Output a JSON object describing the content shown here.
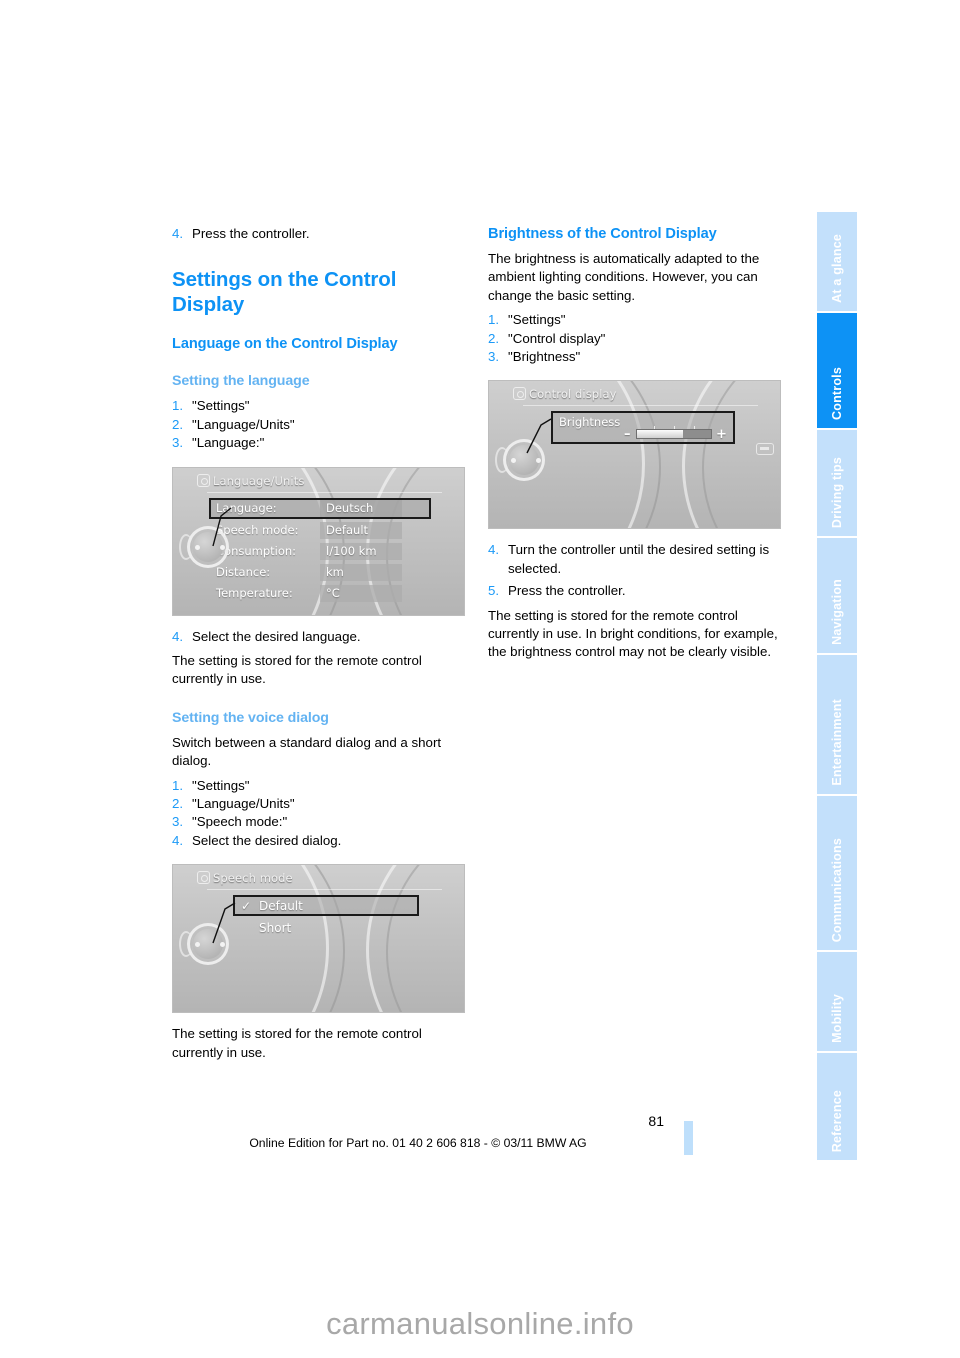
{
  "document": {
    "page_number": "81",
    "edition_line": "Online Edition for Part no. 01 40 2 606 818 - © 03/11 BMW AG",
    "watermark": "carmanualsonline.info"
  },
  "sidebar": {
    "tabs": [
      {
        "label": "At a glance",
        "active": false
      },
      {
        "label": "Controls",
        "active": true
      },
      {
        "label": "Driving tips",
        "active": false
      },
      {
        "label": "Navigation",
        "active": false
      },
      {
        "label": "Entertainment",
        "active": false
      },
      {
        "label": "Communications",
        "active": false
      },
      {
        "label": "Mobility",
        "active": false
      },
      {
        "label": "Reference",
        "active": false
      }
    ],
    "active_color": "#0d92f5",
    "inactive_color": "#c3e0fb"
  },
  "left_column": {
    "step4_top": {
      "num": "4.",
      "text": "Press the controller."
    },
    "h1": "Settings on the Control Display",
    "h2_language": "Language on the Control Display",
    "h3_setting_language": "Setting the language",
    "language_steps": [
      {
        "num": "1.",
        "text": "\"Settings\""
      },
      {
        "num": "2.",
        "text": "\"Language/Units\""
      },
      {
        "num": "3.",
        "text": "\"Language:\""
      }
    ],
    "figure_language": {
      "title": "Language/Units",
      "rows": [
        {
          "label": "Language:",
          "value": "Deutsch",
          "selected": true
        },
        {
          "label": "Speech mode:",
          "value": "Default",
          "selected": false
        },
        {
          "label": "Consumption:",
          "value": "l/100 km",
          "selected": false
        },
        {
          "label": "Distance:",
          "value": "km",
          "selected": false
        },
        {
          "label": "Temperature:",
          "value": "°C",
          "selected": false
        }
      ]
    },
    "language_step4": {
      "num": "4.",
      "text": "Select the desired language."
    },
    "stored_note_1": "The setting is stored for the remote control currently in use.",
    "h3_voice_dialog": "Setting the voice dialog",
    "voice_intro": "Switch between a standard dialog and a short dialog.",
    "voice_steps": [
      {
        "num": "1.",
        "text": "\"Settings\""
      },
      {
        "num": "2.",
        "text": "\"Language/Units\""
      },
      {
        "num": "3.",
        "text": "\"Speech mode:\""
      },
      {
        "num": "4.",
        "text": "Select the desired dialog."
      }
    ],
    "figure_speech": {
      "title": "Speech mode",
      "items": [
        {
          "label": "Default",
          "checked": true,
          "selected": true
        },
        {
          "label": "Short",
          "checked": false,
          "selected": false
        }
      ]
    },
    "stored_note_2": "The setting is stored for the remote control currently in use."
  },
  "right_column": {
    "h2_brightness": "Brightness of the Control Display",
    "brightness_intro": "The brightness is automatically adapted to the ambient lighting conditions. However, you can change the basic setting.",
    "brightness_steps": [
      {
        "num": "1.",
        "text": "\"Settings\""
      },
      {
        "num": "2.",
        "text": "\"Control display\""
      },
      {
        "num": "3.",
        "text": "\"Brightness\""
      }
    ],
    "figure_control_display": {
      "title": "Control display",
      "slider_label": "Brightness",
      "minus": "–",
      "plus": "+",
      "fill_percent": 62
    },
    "brightness_steps_after": [
      {
        "num": "4.",
        "text": "Turn the controller until the desired setting is selected."
      },
      {
        "num": "5.",
        "text": "Press the controller."
      }
    ],
    "stored_note_3": "The setting is stored for the remote control currently in use. In bright conditions, for example, the brightness control may not be clearly visible."
  }
}
